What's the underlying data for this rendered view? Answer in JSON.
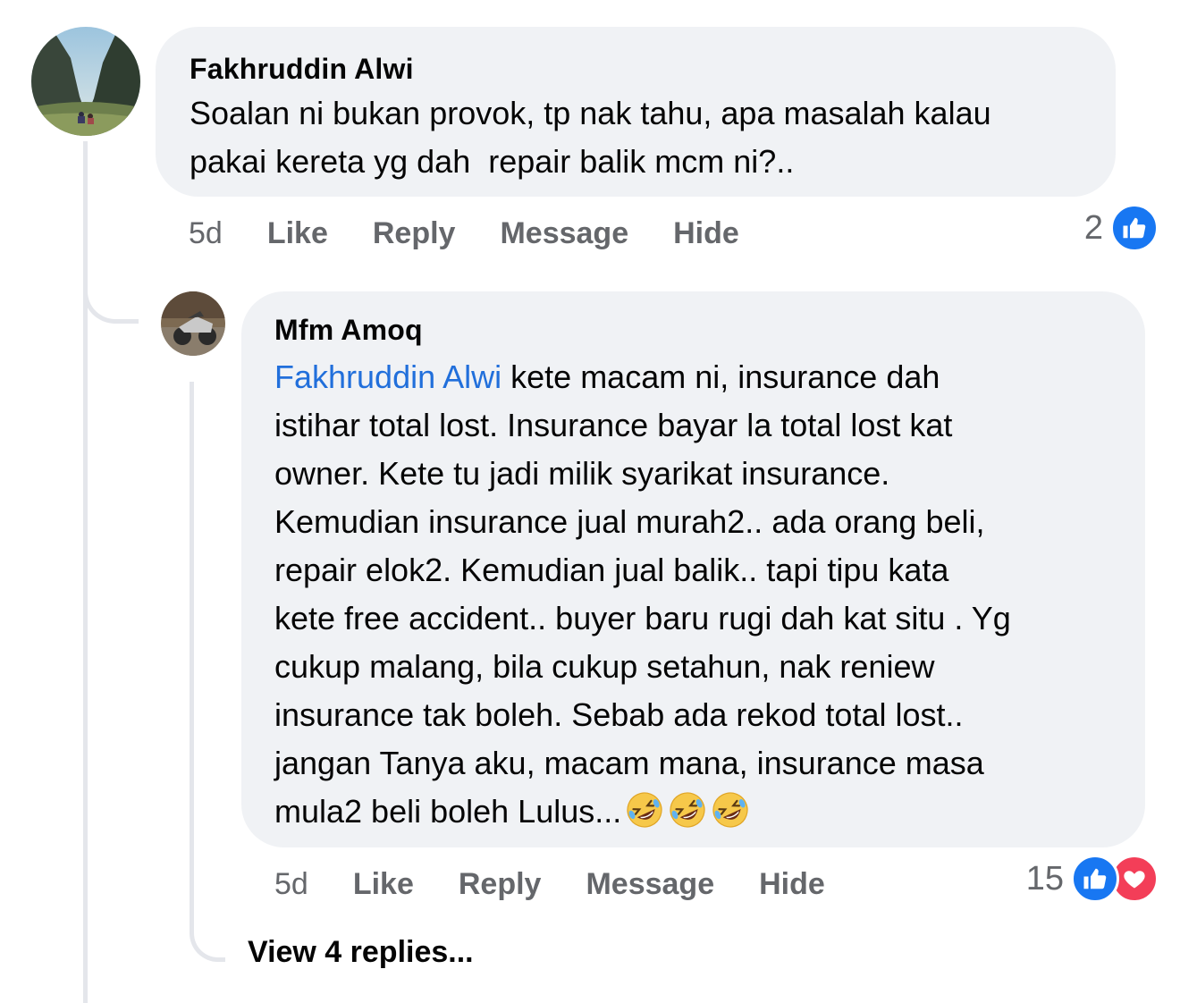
{
  "comment_1": {
    "author": "Fakhruddin Alwi",
    "text": "Soalan ni bukan provok, tp nak tahu, apa masalah kalau\npakai kereta yg dah  repair balik mcm ni?..",
    "time": "5d",
    "actions": {
      "like": "Like",
      "reply": "Reply",
      "message": "Message",
      "hide": "Hide"
    },
    "reaction_count": "2",
    "reaction_icons": [
      "like-icon"
    ]
  },
  "comment_2": {
    "author": "Mfm Amoq",
    "mention": "Fakhruddin Alwi",
    "text": " kete macam ni, insurance dah\nistihar total lost. Insurance bayar la total lost kat\nowner. Kete tu jadi milik syarikat insurance.\nKemudian insurance jual murah2.. ada orang beli,\nrepair elok2. Kemudian jual balik.. tapi tipu kata\nkete free accident.. buyer baru rugi dah kat situ . Yg\ncukup malang, bila cukup setahun, nak reniew\ninsurance tak boleh. Sebab ada rekod total lost..\njangan Tanya aku, macam mana, insurance masa\nmula2 beli boleh Lulus...",
    "emoji_count": 3,
    "emoji_name": "rolling-on-floor-laughing",
    "time": "5d",
    "actions": {
      "like": "Like",
      "reply": "Reply",
      "message": "Message",
      "hide": "Hide"
    },
    "reaction_count": "15",
    "reaction_icons": [
      "like-icon",
      "love-icon"
    ]
  },
  "view_replies": "View 4 replies...",
  "colors": {
    "bubble": "#f0f2f5",
    "mention": "#216fdb",
    "secondary_text": "#65676b",
    "like_blue": "#1877f2",
    "love_red": "#f33e58",
    "thread_line": "#e4e6eb"
  }
}
